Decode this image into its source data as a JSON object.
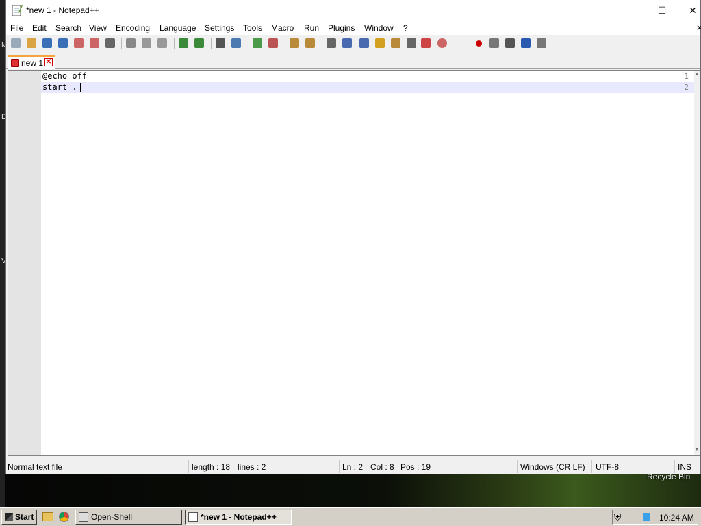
{
  "window": {
    "title": "*new 1 - Notepad++",
    "minimize": "—",
    "maximize": "☐",
    "close": "✕"
  },
  "menubar": {
    "items": [
      "File",
      "Edit",
      "Search",
      "View",
      "Encoding",
      "Language",
      "Settings",
      "Tools",
      "Macro",
      "Run",
      "Plugins",
      "Window",
      "?"
    ],
    "overflow": "✕"
  },
  "toolbar": {
    "icons": [
      "new-file-icon",
      "open-file-icon",
      "save-icon",
      "save-all-icon",
      "close-icon",
      "close-all-icon",
      "print-icon",
      "cut-icon",
      "copy-icon",
      "paste-icon",
      "undo-icon",
      "redo-icon",
      "find-icon",
      "replace-icon",
      "zoom-in-icon",
      "zoom-out-icon",
      "sync-vertical-icon",
      "sync-horizontal-icon",
      "word-wrap-icon",
      "show-all-chars-icon",
      "indent-guide-icon",
      "lang-icon",
      "doc-map-icon",
      "function-list-icon",
      "folder-workspace-icon",
      "monitoring-icon",
      "record-macro-icon",
      "stop-record-icon",
      "play-macro-icon",
      "run-macro-multiple-icon",
      "save-macro-icon"
    ],
    "colors": {
      "accent": "#f6a43c",
      "record": "#cc0000"
    }
  },
  "tabs": [
    {
      "label": "new 1",
      "close": "✕"
    }
  ],
  "editor": {
    "lines": [
      {
        "number": "1",
        "text": "@echo off"
      },
      {
        "number": "2",
        "text": "start ."
      }
    ]
  },
  "status": {
    "file_type": "Normal text file",
    "length": "length : 18",
    "lines": "lines : 2",
    "ln": "Ln : 2",
    "col": "Col : 8",
    "pos": "Pos : 19",
    "eol": "Windows (CR LF)",
    "encoding": "UTF-8",
    "mode": "INS"
  },
  "desktop": {
    "recycle_bin": "Recycle Bin",
    "left_letters": [
      "M",
      "D",
      "V"
    ]
  },
  "taskbar": {
    "start": "Start",
    "buttons": [
      {
        "label": "Open-Shell"
      },
      {
        "label": "*new 1 - Notepad++"
      }
    ],
    "clock": "10:24 AM"
  }
}
